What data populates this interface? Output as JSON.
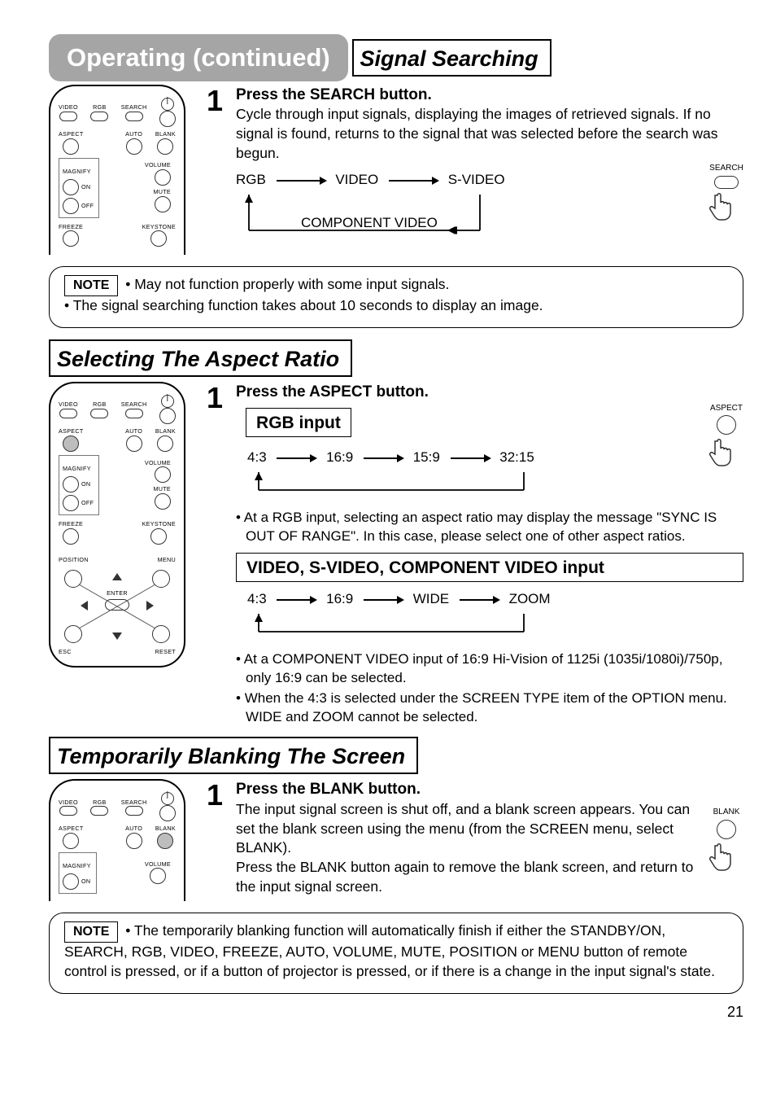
{
  "page_number": "21",
  "title_bar": "Operating (continued)",
  "sections": {
    "signal": {
      "heading": "Signal Searching",
      "step_num": "1",
      "step_head": "Press the SEARCH button.",
      "step_body": "Cycle through input signals, displaying the images of retrieved signals. If no signal is found, returns to the signal that was selected before the search was begun.",
      "flow": {
        "a": "RGB",
        "b": "VIDEO",
        "c": "S-VIDEO",
        "d": "COMPONENT VIDEO"
      },
      "thumb_label": "SEARCH",
      "note_label": "NOTE",
      "note1": "May not function properly with some input signals.",
      "note2": "The signal searching function takes about 10 seconds to display an image."
    },
    "aspect": {
      "heading": "Selecting The Aspect Ratio",
      "step_num": "1",
      "step_head": "Press the ASPECT button.",
      "thumb_label": "ASPECT",
      "rgb_header": "RGB input",
      "rgb_flow": {
        "a": "4:3",
        "b": "16:9",
        "c": "15:9",
        "d": "32:15"
      },
      "rgb_bullet": "At a RGB input, selecting an aspect ratio may display the message \"SYNC IS OUT OF RANGE\". In this case, please select one of other aspect ratios.",
      "vid_header": "VIDEO, S-VIDEO, COMPONENT VIDEO input",
      "vid_flow": {
        "a": "4:3",
        "b": "16:9",
        "c": "WIDE",
        "d": "ZOOM"
      },
      "vid_bullet1": "At a COMPONENT VIDEO input of 16:9 Hi-Vision of 1125i (1035i/1080i)/750p, only 16:9 can be selected.",
      "vid_bullet2": "When the 4:3 is selected under the SCREEN TYPE item of the OPTION menu. WIDE and ZOOM cannot be selected."
    },
    "blank": {
      "heading": "Temporarily Blanking The Screen",
      "step_num": "1",
      "step_head": "Press the BLANK button.",
      "step_body1": "The input signal screen is shut off, and a blank screen appears. You can set the blank screen using the menu (from the SCREEN menu, select BLANK).",
      "step_body2": "Press the BLANK button again to remove the blank screen, and return to the input signal screen.",
      "thumb_label": "BLANK",
      "note_label": "NOTE",
      "note_body": "The temporarily blanking function will automatically finish if either the STANDBY/ON, SEARCH, RGB, VIDEO, FREEZE, AUTO, VOLUME, MUTE, POSITION or MENU button of remote control is pressed, or if a button of projector is pressed, or if there is a change in the input signal's state."
    }
  },
  "remote": {
    "video": "VIDEO",
    "rgb": "RGB",
    "search": "SEARCH",
    "aspect": "ASPECT",
    "auto": "AUTO",
    "blank": "BLANK",
    "magnify": "MAGNIFY",
    "volume": "VOLUME",
    "mute": "MUTE",
    "on": "ON",
    "off": "OFF",
    "freeze": "FREEZE",
    "keystone": "KEYSTONE",
    "position": "POSITION",
    "menu": "MENU",
    "enter": "ENTER",
    "esc": "ESC",
    "reset": "RESET"
  }
}
